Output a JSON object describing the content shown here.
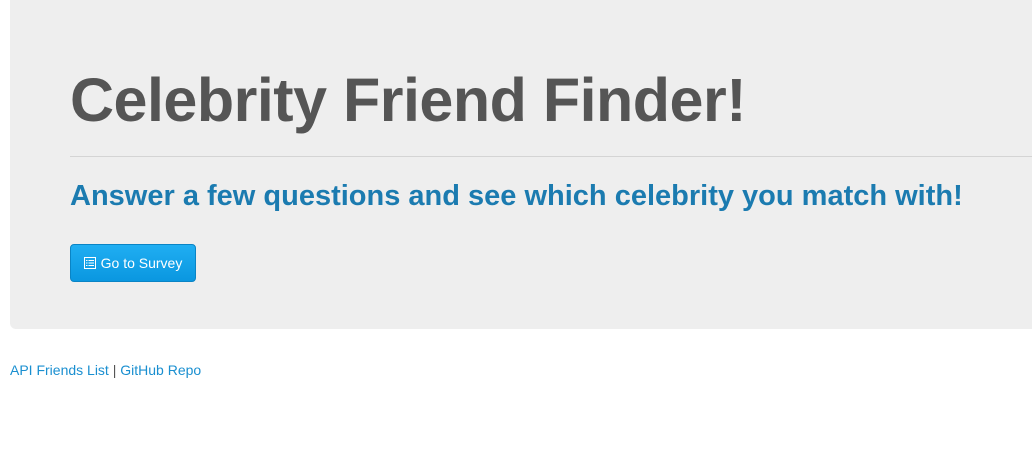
{
  "jumbotron": {
    "title": "Celebrity Friend Finder!",
    "subtitle": "Answer a few questions and see which celebrity you match with!",
    "button": {
      "label": "Go to Survey",
      "icon": "list-alt-icon"
    }
  },
  "footer": {
    "link_api": "API Friends List",
    "separator": "|",
    "link_github": "GitHub Repo"
  },
  "colors": {
    "jumbotron_bg": "#eeeeee",
    "title": "#555555",
    "subtitle": "#1b7bb0",
    "button": "#0a97e0",
    "link": "#1a8fd0"
  }
}
